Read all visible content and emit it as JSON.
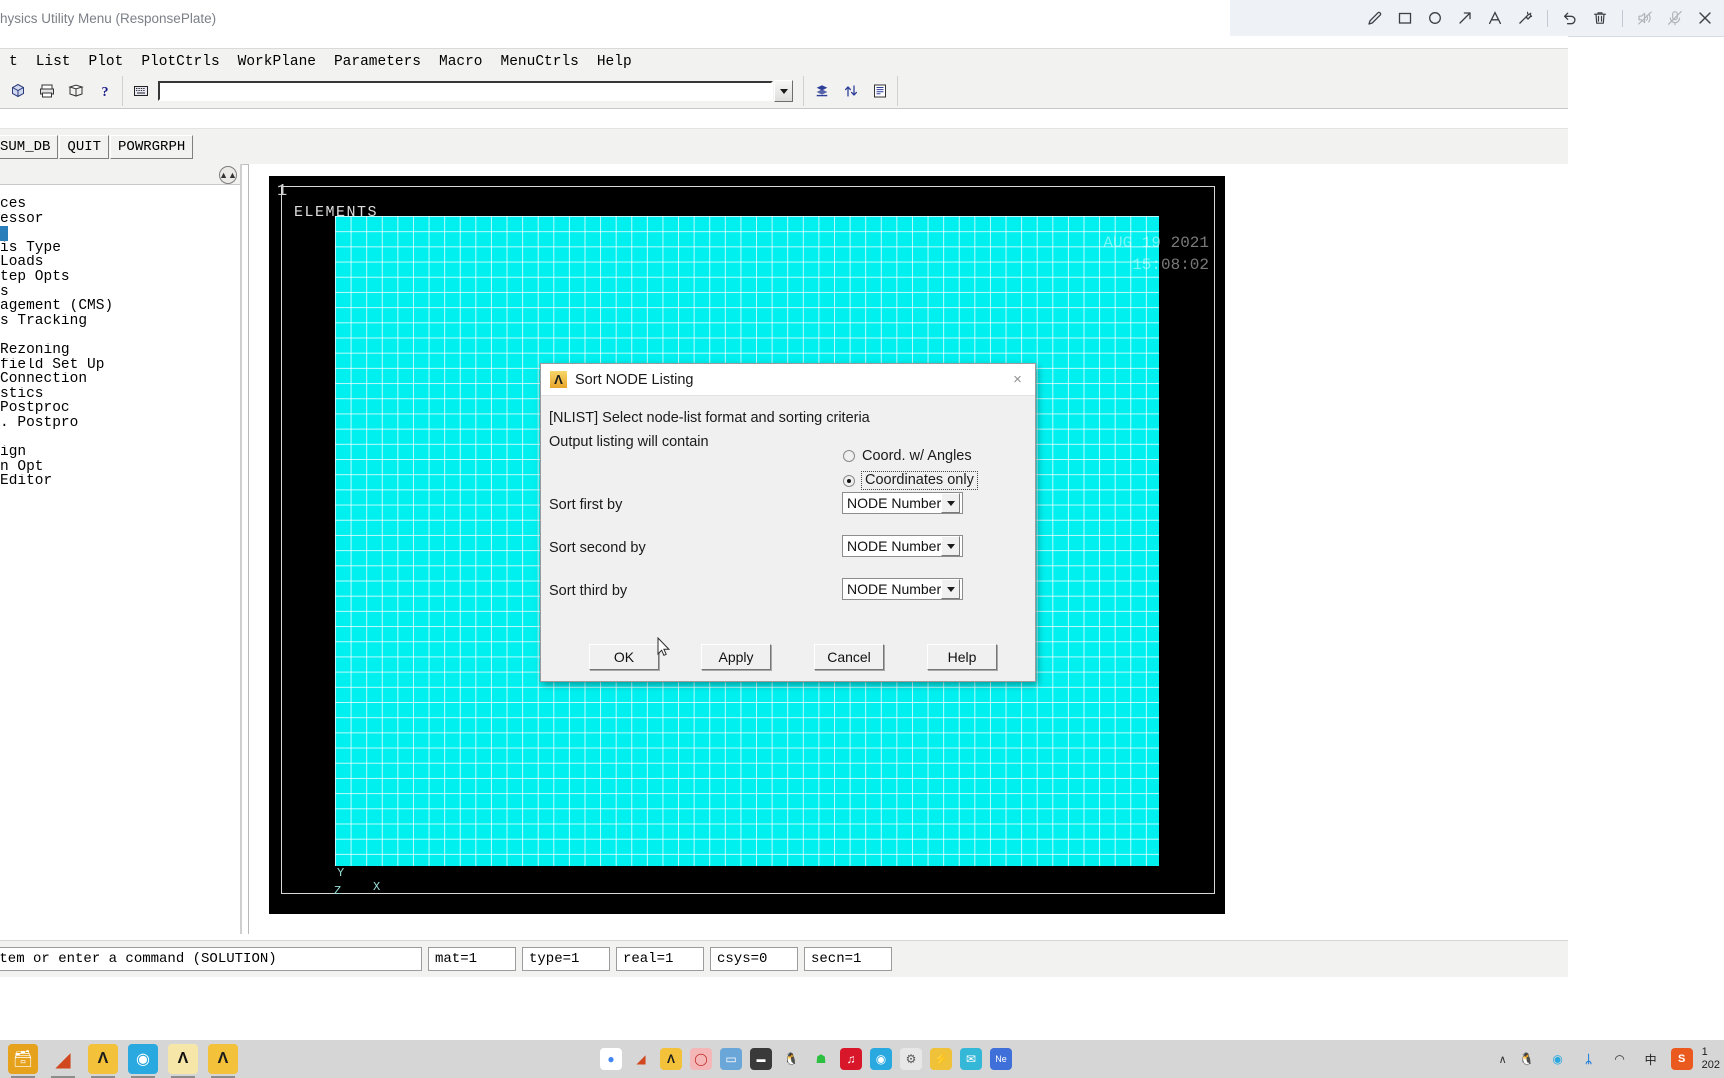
{
  "capture": {
    "window_title": "hysics Utility Menu (ResponsePlate)",
    "tools": [
      {
        "name": "pen-icon",
        "label": "Pen"
      },
      {
        "name": "rectangle-icon",
        "label": "Rectangle"
      },
      {
        "name": "ellipse-icon",
        "label": "Ellipse"
      },
      {
        "name": "arrow-icon",
        "label": "Arrow"
      },
      {
        "name": "text-icon",
        "label": "Text"
      },
      {
        "name": "magic-wand-icon",
        "label": "Highlight"
      },
      {
        "name": "undo-icon",
        "label": "Undo"
      },
      {
        "name": "trash-icon",
        "label": "Delete"
      },
      {
        "name": "speaker-mute-icon",
        "label": "Mute speaker"
      },
      {
        "name": "microphone-mute-icon",
        "label": "Mute microphone"
      },
      {
        "name": "close-icon",
        "label": "Close"
      }
    ]
  },
  "ansys": {
    "utility_menu": [
      {
        "label": "t",
        "accel": ""
      },
      {
        "label": "List",
        "accel": "L"
      },
      {
        "label": "Plot",
        "accel": "P"
      },
      {
        "label": "PlotCtrls",
        "accel": "C"
      },
      {
        "label": "WorkPlane",
        "accel": "W"
      },
      {
        "label": "Parameters",
        "accel": "r"
      },
      {
        "label": "Macro",
        "accel": "M"
      },
      {
        "label": "MenuCtrls",
        "accel": "u"
      },
      {
        "label": "Help",
        "accel": "H"
      }
    ],
    "toolbar_icons": [
      {
        "name": "new-analysis-icon"
      },
      {
        "name": "print-icon"
      },
      {
        "name": "report-generator-icon"
      },
      {
        "name": "help-icon"
      },
      {
        "name": "command-input-icon"
      },
      {
        "name": "raise-hidden-icon"
      },
      {
        "name": "reset-picking-icon"
      },
      {
        "name": "contact-manager-icon"
      }
    ],
    "command_input": {
      "value": "",
      "placeholder": ""
    },
    "abbr_buttons": [
      "SUM_DB",
      "QUIT",
      "POWRGRPH"
    ],
    "tree_items": [
      "ces",
      "essor",
      "",
      "is Type",
      " Loads",
      "tep Opts",
      "s",
      "agement (CMS)",
      "s Tracking",
      "",
      " Rezoning",
      "field Set Up",
      "Connection",
      "stics",
      " Postproc",
      ". Postpro",
      "",
      "ign",
      "n Opt",
      "Editor"
    ],
    "tree_selected_index": 2,
    "graphics": {
      "plot_number": "1",
      "plot_title": "ELEMENTS",
      "date_line1": "AUG 19 2021",
      "date_line2": "15:08:02",
      "visible_time_tail": ":02",
      "triad_x": "X",
      "triad_y": "Y",
      "triad_z": "Z",
      "mesh_color": "#00f0f0",
      "background_color": "#000000"
    },
    "status": {
      "prompt": " item or enter a command (SOLUTION)",
      "cells": [
        "mat=1",
        "type=1",
        "real=1",
        "csys=0",
        "secn=1"
      ]
    }
  },
  "dialog": {
    "title": "Sort NODE Listing",
    "close_label": "×",
    "command_line": "[NLIST]  Select node-list format and sorting criteria",
    "section_label": "Output listing will contain",
    "radios": [
      {
        "label": "Coord. w/ Angles",
        "checked": false,
        "focused": false
      },
      {
        "label": "Coordinates only",
        "checked": true,
        "focused": true
      }
    ],
    "fields": [
      {
        "label": "Sort first by",
        "value": "NODE Number"
      },
      {
        "label": "Sort second by",
        "value": "NODE Number"
      },
      {
        "label": "Sort third by",
        "value": "NODE Number"
      }
    ],
    "buttons": [
      "OK",
      "Apply",
      "Cancel",
      "Help"
    ]
  },
  "taskbar": {
    "left_apps": [
      {
        "name": "file-explorer-icon",
        "glyph": "🗂",
        "bg": "#e6a21c",
        "fg": "#ffffff"
      },
      {
        "name": "matlab-icon",
        "glyph": "◢",
        "bg": "transparent",
        "fg": "#d2481e"
      },
      {
        "name": "ansys-mechanical-apdl-icon",
        "glyph": "Λ",
        "bg": "#f3c13a",
        "fg": "#1b1b1b"
      },
      {
        "name": "potplayer-icon",
        "glyph": "◉",
        "bg": "#2aa9e0",
        "fg": "#ffffff"
      },
      {
        "name": "ansys-workbench-icon",
        "glyph": "Λ",
        "bg": "#f6e6a8",
        "fg": "#111111"
      },
      {
        "name": "ansys-product-launcher-icon",
        "glyph": "Λ",
        "bg": "#f3c13a",
        "fg": "#1b1b1b"
      }
    ],
    "center_apps": [
      {
        "name": "chrome-icon",
        "glyph": "●",
        "bg": "#ffffff",
        "fg": "#4285f4"
      },
      {
        "name": "matlab-icon",
        "glyph": "◢",
        "bg": "transparent",
        "fg": "#d2481e"
      },
      {
        "name": "ansys-icon",
        "glyph": "Λ",
        "bg": "#f3c13a",
        "fg": "#1b1b1b"
      },
      {
        "name": "screenshot-tool-icon",
        "glyph": "◯",
        "bg": "#f4b6b6",
        "fg": "#c02626"
      },
      {
        "name": "remote-desktop-icon",
        "glyph": "▭",
        "bg": "#6aa6d8",
        "fg": "#ffffff"
      },
      {
        "name": "terminal-icon",
        "glyph": "▬",
        "bg": "#3a3a3a",
        "fg": "#ffffff"
      },
      {
        "name": "qq-icon",
        "glyph": "🐧",
        "bg": "transparent",
        "fg": "#222222"
      },
      {
        "name": "wechat-icon",
        "glyph": "☗",
        "bg": "transparent",
        "fg": "#2dbf3f"
      },
      {
        "name": "netease-music-icon",
        "glyph": "♫",
        "bg": "#d8182a",
        "fg": "#ffffff"
      },
      {
        "name": "potplayer-icon",
        "glyph": "◉",
        "bg": "#2aa9e0",
        "fg": "#ffffff"
      },
      {
        "name": "settings-icon",
        "glyph": "⚙",
        "bg": "#e7e7e7",
        "fg": "#555555"
      },
      {
        "name": "thunder-icon",
        "glyph": "⚡",
        "bg": "#f0c23a",
        "fg": "#ffffff"
      },
      {
        "name": "foxmail-icon",
        "glyph": "✉",
        "bg": "#35b8d8",
        "fg": "#ffffff"
      },
      {
        "name": "notes-icon",
        "glyph": "Ne",
        "bg": "#3f6fd8",
        "fg": "#ffffff"
      }
    ],
    "tray": [
      {
        "name": "tray-expand-icon",
        "glyph": "∧"
      },
      {
        "name": "qq-tray-icon",
        "glyph": "🐧"
      },
      {
        "name": "potplayer-tray-icon",
        "glyph": "◉"
      },
      {
        "name": "bluetooth-icon",
        "glyph": "ᛦ"
      },
      {
        "name": "wifi-icon",
        "glyph": "◠"
      },
      {
        "name": "ime-icon",
        "glyph": "中"
      },
      {
        "name": "sogou-input-icon",
        "glyph": "S"
      }
    ],
    "clock_line1": "1",
    "clock_line2": "202"
  }
}
